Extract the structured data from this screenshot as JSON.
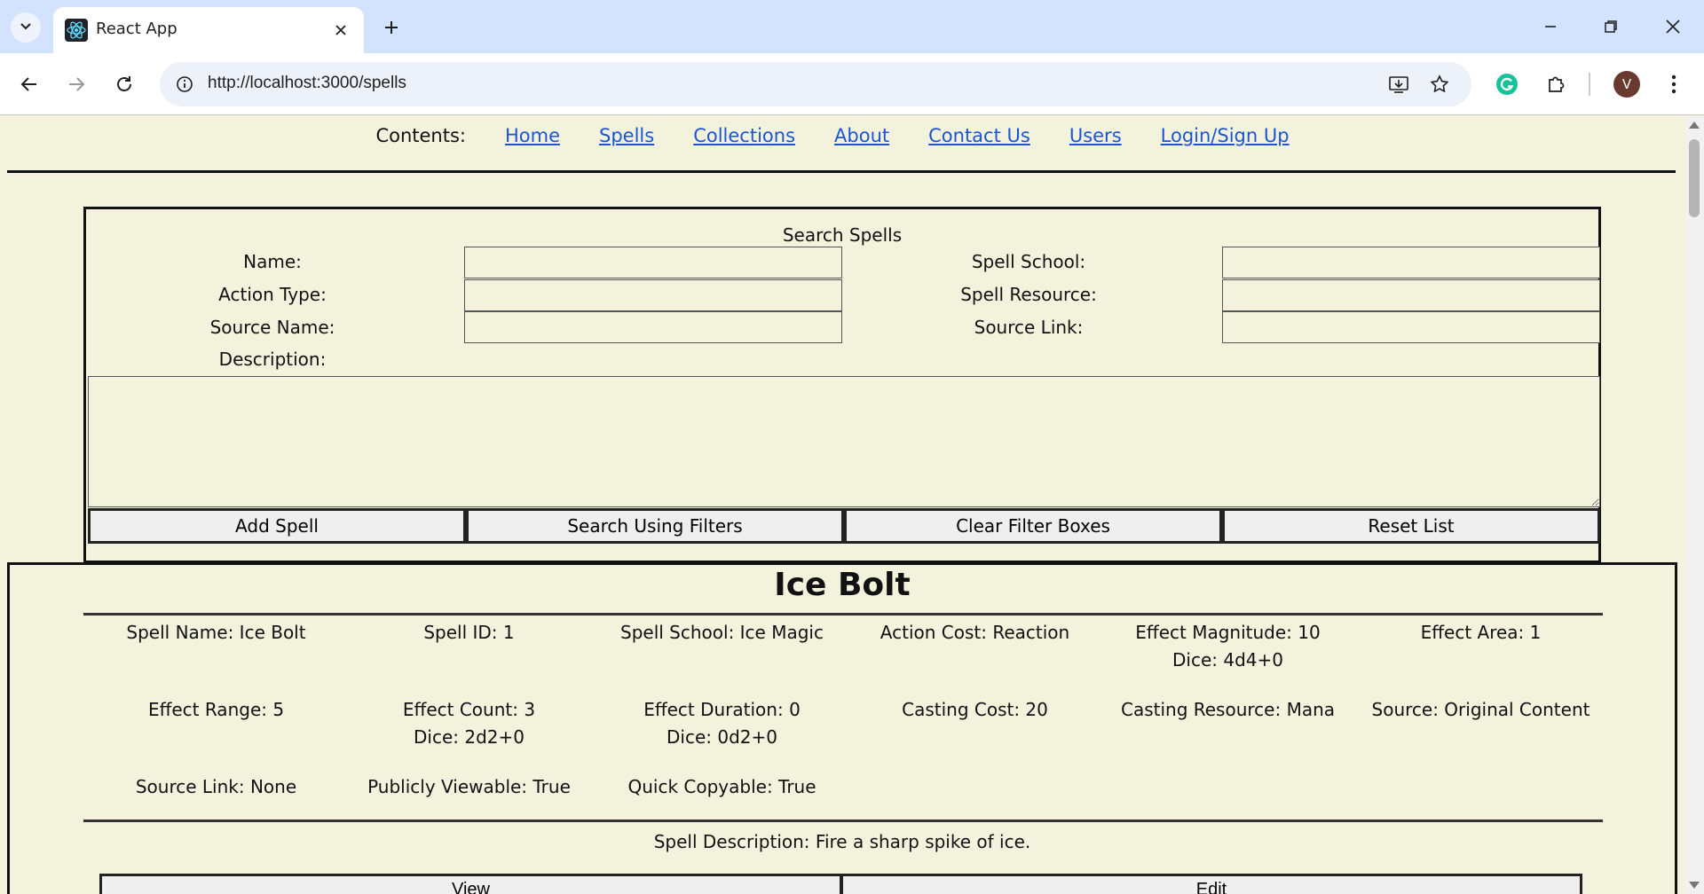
{
  "browser": {
    "tab_title": "React App",
    "url": "http://localhost:3000/spells",
    "avatar_letter": "V",
    "accent": "#d3e3fd"
  },
  "nav": {
    "label": "Contents:",
    "links": [
      "Home",
      "Spells",
      "Collections",
      "About",
      "Contact Us",
      "Users",
      "Login/Sign Up"
    ]
  },
  "search": {
    "title": "Search Spells",
    "fields": {
      "name": "Name:",
      "action_type": "Action Type:",
      "source_name": "Source Name:",
      "description": "Description:",
      "spell_school": "Spell School:",
      "spell_resource": "Spell Resource:",
      "source_link": "Source Link:"
    },
    "values": {
      "name": "",
      "action_type": "",
      "source_name": "",
      "description": "",
      "spell_school": "",
      "spell_resource": "",
      "source_link": ""
    },
    "buttons": [
      "Add Spell",
      "Search Using Filters",
      "Clear Filter Boxes",
      "Reset List"
    ]
  },
  "spell": {
    "title": "Ice Bolt",
    "fields": [
      {
        "text": "Spell Name: Ice Bolt",
        "sub": ""
      },
      {
        "text": "Spell ID: 1",
        "sub": ""
      },
      {
        "text": "Spell School: Ice Magic",
        "sub": ""
      },
      {
        "text": "Action Cost: Reaction",
        "sub": ""
      },
      {
        "text": "Effect Magnitude: 10",
        "sub": "Dice: 4d4+0"
      },
      {
        "text": "Effect Area: 1",
        "sub": ""
      },
      {
        "text": "Effect Range: 5",
        "sub": ""
      },
      {
        "text": "Effect Count: 3",
        "sub": "Dice: 2d2+0"
      },
      {
        "text": "Effect Duration: 0",
        "sub": "Dice: 0d2+0"
      },
      {
        "text": "Casting Cost: 20",
        "sub": ""
      },
      {
        "text": "Casting Resource: Mana",
        "sub": ""
      },
      {
        "text": "Source: Original Content",
        "sub": ""
      },
      {
        "text": "Source Link: None",
        "sub": ""
      },
      {
        "text": "Publicly Viewable: True",
        "sub": ""
      },
      {
        "text": "Quick Copyable: True",
        "sub": ""
      }
    ],
    "description": "Spell Description: Fire a sharp spike of ice.",
    "buttons": {
      "view": "View",
      "edit": "Edit"
    }
  }
}
